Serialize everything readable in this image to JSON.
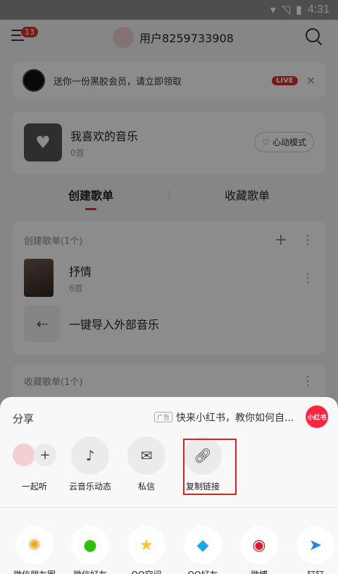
{
  "status_bar": {
    "time": "4:31"
  },
  "header": {
    "badge": "13",
    "user_name": "用户8259733908"
  },
  "promo": {
    "text": "送你一份黑胶会员，请立即领取",
    "live": "LIVE"
  },
  "favorites": {
    "title": "我喜欢的音乐",
    "count": "0首",
    "mode_button": "心动模式"
  },
  "tabs": [
    {
      "label": "创建歌单"
    },
    {
      "label": "收藏歌单"
    }
  ],
  "created": {
    "header": "创建歌单(1个)",
    "items": [
      {
        "title": "抒情",
        "count": "6首"
      }
    ],
    "import_label": "一键导入外部音乐"
  },
  "collected": {
    "header": "收藏歌单(1个)"
  },
  "share": {
    "title": "分享",
    "ad_tag": "广告",
    "ad_text": "快来小红书，教你如何自...",
    "ad_logo": "小红书",
    "actions": [
      {
        "label": "一起听"
      },
      {
        "label": "云音乐动态"
      },
      {
        "label": "私信"
      },
      {
        "label": "复制链接"
      }
    ],
    "apps": [
      {
        "label": "微信朋友圈"
      },
      {
        "label": "微信好友"
      },
      {
        "label": "QQ空间"
      },
      {
        "label": "QQ好友"
      },
      {
        "label": "微博"
      },
      {
        "label": "钉钉"
      }
    ]
  }
}
